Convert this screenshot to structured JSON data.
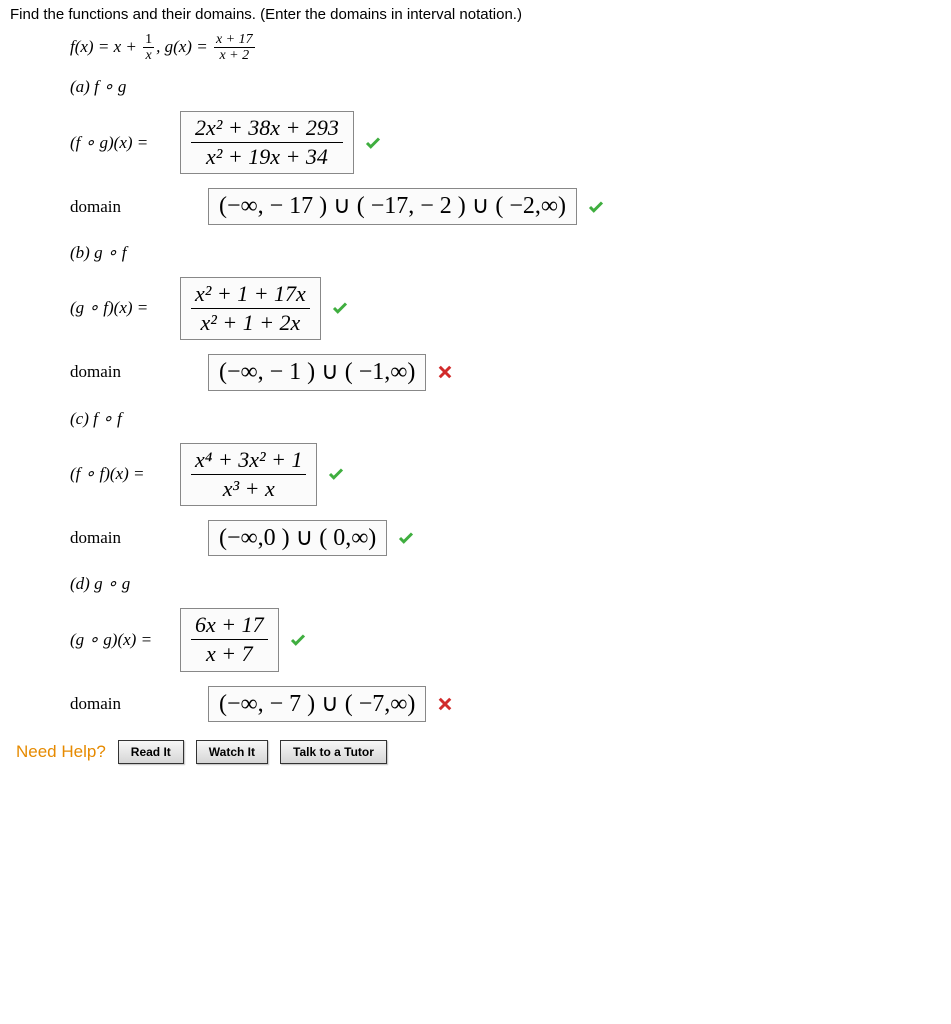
{
  "prompt": "Find the functions and their domains. (Enter the domains in interval notation.)",
  "functions": {
    "f_lhs": "f(x) = x + ",
    "f_frac_num": "1",
    "f_frac_den": "x",
    "sep": ",   ",
    "g_lhs": "g(x) = ",
    "g_frac_num": "x + 17",
    "g_frac_den": "x + 2"
  },
  "parts": {
    "a": {
      "label": "(a)    f ∘ g",
      "expr_lhs": "(f ∘ g)(x) = ",
      "expr_num": "2x² + 38x + 293",
      "expr_den": "x² + 19x + 34",
      "expr_correct": true,
      "domain_label": "domain",
      "domain_val": "(−∞, − 17 ) ∪ ( −17, − 2 ) ∪ ( −2,∞)",
      "domain_correct": true
    },
    "b": {
      "label": "(b)    g ∘ f",
      "expr_lhs": "(g ∘ f)(x) = ",
      "expr_num": "x² + 1 + 17x",
      "expr_den": "x² + 1 + 2x",
      "expr_correct": true,
      "domain_label": "domain",
      "domain_val": "(−∞, − 1 ) ∪ ( −1,∞)",
      "domain_correct": false
    },
    "c": {
      "label": "(c)    f ∘ f",
      "expr_lhs": "(f ∘ f)(x) = ",
      "expr_num": "x⁴ + 3x² + 1",
      "expr_den": "x³ + x",
      "expr_correct": true,
      "domain_label": "domain",
      "domain_val": "(−∞,0 ) ∪ ( 0,∞)",
      "domain_correct": true
    },
    "d": {
      "label": "(d)    g ∘ g",
      "expr_lhs": "(g ∘ g)(x) = ",
      "expr_num": "6x + 17",
      "expr_den": "x + 7",
      "expr_correct": true,
      "domain_label": "domain",
      "domain_val": "(−∞, − 7 ) ∪ ( −7,∞)",
      "domain_correct": false
    }
  },
  "help": {
    "label": "Need Help?",
    "read": "Read It",
    "watch": "Watch It",
    "tutor": "Talk to a Tutor"
  },
  "icons": {
    "check": "check-icon",
    "cross": "cross-icon"
  }
}
